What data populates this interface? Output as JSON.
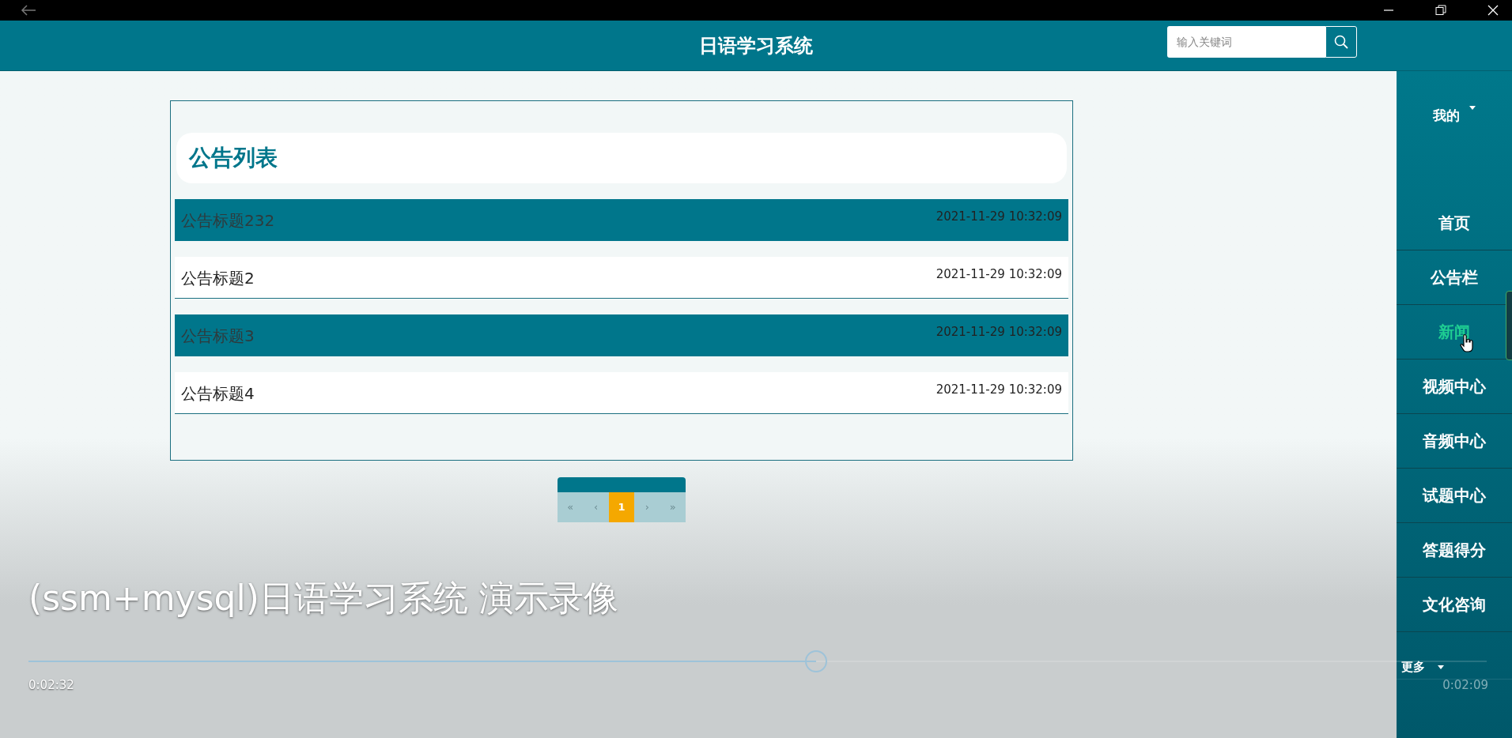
{
  "header": {
    "title": "日语学习系统",
    "search": {
      "placeholder": "输入关键词"
    }
  },
  "notices": {
    "title": "公告列表",
    "rows": [
      {
        "title": "公告标题232",
        "time": "2021-11-29 10:32:09",
        "highlighted": true
      },
      {
        "title": "公告标题2",
        "time": "2021-11-29 10:32:09",
        "highlighted": false
      },
      {
        "title": "公告标题3",
        "time": "2021-11-29 10:32:09",
        "highlighted": true
      },
      {
        "title": "公告标题4",
        "time": "2021-11-29 10:32:09",
        "highlighted": false
      }
    ]
  },
  "pagination": {
    "pages": [
      {
        "label": "«",
        "kind": "nav"
      },
      {
        "label": "‹",
        "kind": "nav"
      },
      {
        "label": "1",
        "kind": "page",
        "selected": true
      },
      {
        "label": "›",
        "kind": "nav"
      },
      {
        "label": "»",
        "kind": "nav"
      }
    ]
  },
  "sidebar": {
    "items": [
      {
        "label": "我的",
        "kind": "dropdown",
        "hovered": false
      },
      {
        "label": "首页",
        "kind": "link",
        "hovered": false
      },
      {
        "label": "公告栏",
        "kind": "link",
        "hovered": false
      },
      {
        "label": "新闻",
        "kind": "link",
        "hovered": true
      },
      {
        "label": "视频中心",
        "kind": "link",
        "hovered": false
      },
      {
        "label": "音频中心",
        "kind": "link",
        "hovered": false
      },
      {
        "label": "试题中心",
        "kind": "link",
        "hovered": false
      },
      {
        "label": "答题得分",
        "kind": "link",
        "hovered": false
      },
      {
        "label": "文化咨询",
        "kind": "link",
        "hovered": false
      },
      {
        "label": "更多",
        "kind": "dropdown",
        "hovered": false
      }
    ]
  },
  "player": {
    "caption": "(ssm+mysql)日语学习系统 演示录像",
    "level": 0.54,
    "elapsed": "0:02:32",
    "remaining": "0:02:09"
  }
}
